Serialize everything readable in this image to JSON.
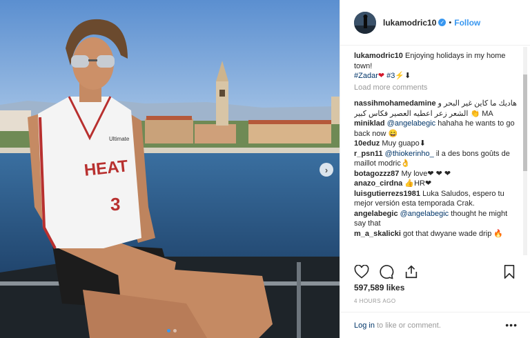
{
  "post": {
    "username": "lukamodric10",
    "follow_label": "Follow",
    "separator": "•",
    "caption": {
      "username": "lukamodric10",
      "text": "Enjoying holidays in my home town!",
      "hashtag_zadar": "#Zadar",
      "hashtag_three": "#3",
      "emoji_after_zadar": "❤",
      "emoji_lightning": "⚡",
      "emoji_down": "⬇"
    },
    "load_more": "Load more comments",
    "comments": [
      {
        "user": "nassihmohamedamine",
        "text": "هاديك ما كاين غير البحر و الشعر زعر اعطيه العصير فكاس كبير 👏 MA"
      },
      {
        "user": "miniklad",
        "mention": "@angelabegic",
        "text": "hahaha he wants to go back now 😄"
      },
      {
        "user": "10eduz",
        "text": "Muy guapo⬇"
      },
      {
        "user": "r_psn11",
        "mention": "@thiokerinho_",
        "text": "il a des bons goûts de maillot modric👌"
      },
      {
        "user": "botagozzz87",
        "text": "My love❤ ❤ ❤"
      },
      {
        "user": "anazo_cirdna",
        "text": "👍HR❤"
      },
      {
        "user": "luisgutierrezs1981",
        "text": "Luka Saludos, espero tu mejor versión esta temporada Crak."
      },
      {
        "user": "angelabegic",
        "mention": "@angelabegic",
        "text": "thought he might say that"
      },
      {
        "user": "m_a_skalicki",
        "text": "got that dwyane wade drip 🔥"
      }
    ],
    "likes": "597,589 likes",
    "time": "4 HOURS AGO",
    "footer": {
      "login_label": "Log in",
      "rest": "to like or comment.",
      "more": "•••"
    },
    "jersey": {
      "team": "HEAT",
      "number": "3",
      "sponsor": "Ultimate"
    },
    "icons": {
      "like": "heart-icon",
      "comment": "comment-icon",
      "share": "share-icon",
      "save": "bookmark-icon",
      "next": "chevron-right-icon"
    },
    "carousel": {
      "slides": 2,
      "active": 1
    },
    "colors": {
      "accent": "#3897f0",
      "link": "#003569",
      "muted": "#999999",
      "heart": "#d4182c"
    }
  }
}
